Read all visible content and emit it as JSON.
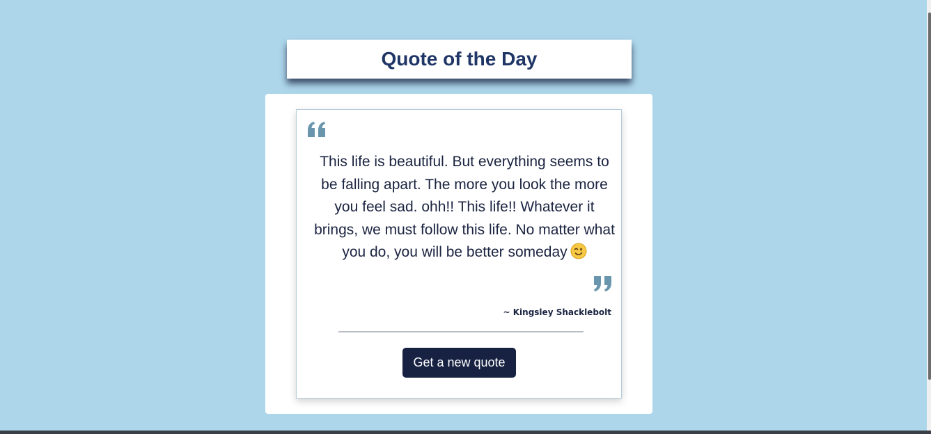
{
  "header": {
    "title": "Quote of the Day"
  },
  "quote": {
    "open_icon": "quote-left-icon",
    "close_icon": "quote-right-icon",
    "text": "This life is beautiful. But everything seems to be falling apart. The more you look the more you feel sad. ohh!! This life!! Whatever it brings, we must follow this life. No matter what you do, you will be better someday",
    "emoji_icon": "winking-face-icon",
    "author": "~ Kingsley Shacklebolt"
  },
  "actions": {
    "new_quote_label": "Get a new quote"
  },
  "colors": {
    "background": "#add6eb",
    "title_text": "#1f3566",
    "quote_icon": "#6a96ad",
    "button_bg": "#172243",
    "button_text": "#ffffff"
  }
}
